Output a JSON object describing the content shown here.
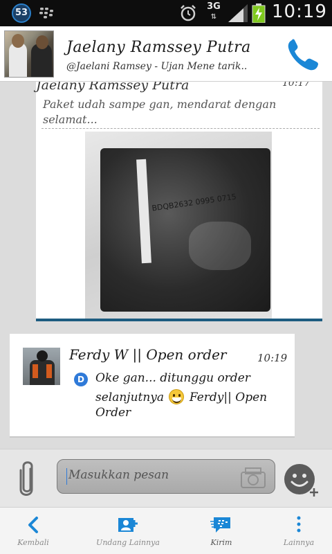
{
  "status_bar": {
    "notification_count": "53",
    "network": "3G",
    "time": "10:19"
  },
  "header": {
    "contact_name": "Jaelany Ramssey Putra",
    "contact_status": "@Jaelani Ramsey - Ujan Mene tarik..",
    "call_icon": "phone-icon"
  },
  "quoted_message": {
    "sender": "Jaelany Ramssey Putra",
    "time": "10:17",
    "text": "Paket udah sampe gan, mendarat dengan selamat...",
    "photo_text": "BDQB2632 0995 0715"
  },
  "message": {
    "sender": "Ferdy W || Open order",
    "time": "10:19",
    "delivered_badge": "D",
    "line1": "Oke gan... ditunggu order",
    "line2_a": "selanjutnya",
    "line2_b": "Ferdy|| Open",
    "line3": "Order"
  },
  "compose": {
    "placeholder": "Masukkan pesan"
  },
  "nav": {
    "items": [
      {
        "label": "Kembali",
        "icon": "back-arrow-icon"
      },
      {
        "label": "Undang Lainnya",
        "icon": "invite-contact-icon"
      },
      {
        "label": "Kirim",
        "icon": "send-bbm-icon"
      },
      {
        "label": "Lainnya",
        "icon": "more-vertical-icon"
      }
    ]
  },
  "colors": {
    "accent_blue": "#2f7ad8",
    "status_bar": "#0d0d0d",
    "divider_blue": "#1d5c80"
  }
}
